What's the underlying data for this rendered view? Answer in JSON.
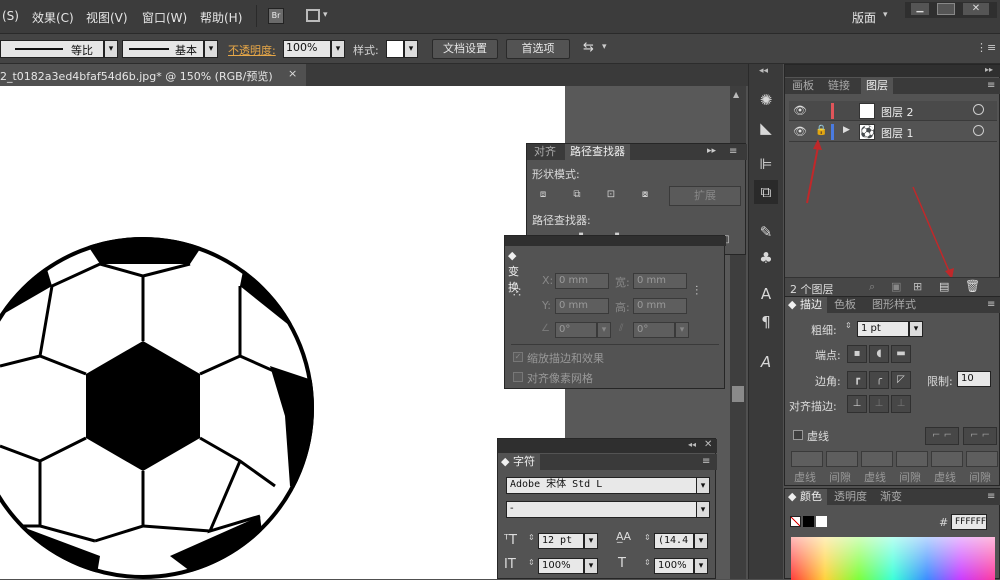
{
  "menubar": {
    "items": [
      "(S)",
      "效果(C)",
      "视图(V)",
      "窗口(W)",
      "帮助(H)"
    ],
    "br_label": "Br",
    "workspace": "版面"
  },
  "controlbar": {
    "stroke_ratio": "等比",
    "stroke_profile": "基本",
    "opacity_label": "不透明度:",
    "opacity_value": "100%",
    "style_label": "样式:",
    "doc_setup": "文档设置",
    "preferences": "首选项"
  },
  "document_tab": {
    "title": "2_t0182a3ed4bfaf54d6b.jpg* @ 150% (RGB/预览)",
    "close": "×"
  },
  "pathfinder": {
    "tabs": [
      "对齐",
      "路径查找器"
    ],
    "shape_modes_label": "形状模式:",
    "expand_label": "扩展",
    "pathfinders_label": "路径查找器:"
  },
  "transform": {
    "tab": "变换",
    "x_label": "X:",
    "x_value": "0 mm",
    "y_label": "Y:",
    "y_value": "0 mm",
    "w_label": "宽:",
    "w_value": "0 mm",
    "h_label": "高:",
    "h_value": "0 mm",
    "rotate_value": "0°",
    "shear_value": "0°",
    "scale_strokes": "缩放描边和效果",
    "align_pixel": "对齐像素网格"
  },
  "character": {
    "tab": "字符",
    "font_family": "Adobe 宋体 Std L",
    "font_style": "-",
    "font_size": "12 pt",
    "leading": "(14.4",
    "vert_scale": "100%",
    "horiz_scale": "100%"
  },
  "layers": {
    "tabs": [
      "画板",
      "链接",
      "图层"
    ],
    "rows": [
      {
        "name": "图层 2",
        "color": "#e0555a"
      },
      {
        "name": "图层 1",
        "color": "#4a7be0"
      }
    ],
    "count": "2 个图层"
  },
  "stroke": {
    "tabs": [
      "描边",
      "色板",
      "图形样式"
    ],
    "weight_label": "粗细:",
    "weight_value": "1 pt",
    "cap_label": "端点:",
    "corner_label": "边角:",
    "limit_label": "限制:",
    "limit_value": "10",
    "align_label": "对齐描边:",
    "dashed_label": "虚线",
    "dash_labels": [
      "虚线",
      "间隙",
      "虚线",
      "间隙",
      "虚线",
      "间隙"
    ]
  },
  "color": {
    "tabs": [
      "颜色",
      "透明度",
      "渐变"
    ],
    "hex_label": "#",
    "hex_value": "FFFFFF"
  },
  "accent_colors": {
    "annotation_arrow": "#c0282a",
    "opacity_label": "#e8a848"
  }
}
